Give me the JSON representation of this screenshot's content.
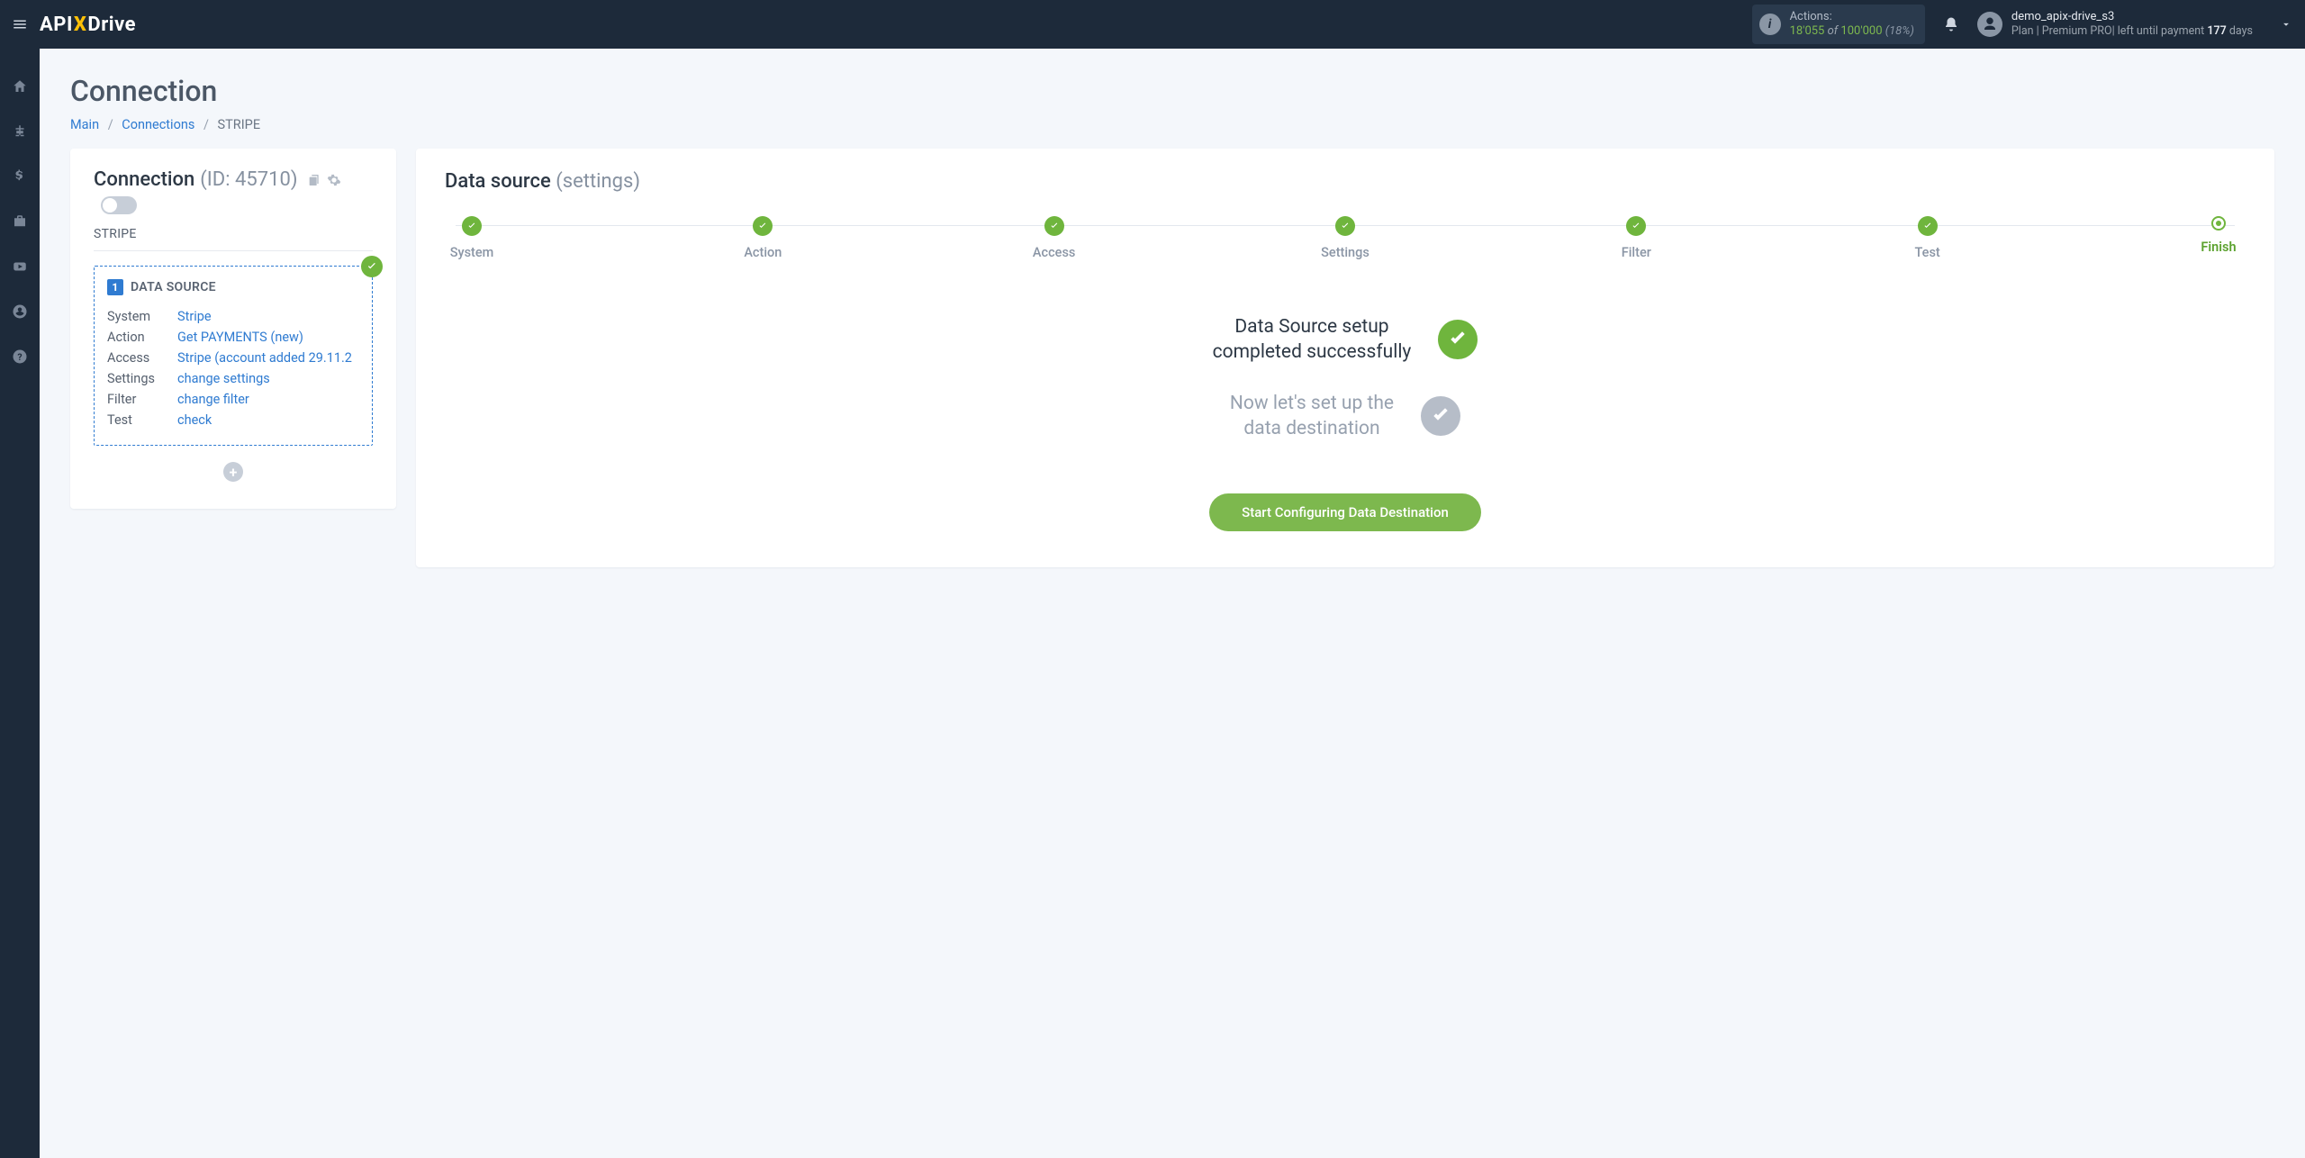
{
  "header": {
    "logo_pre": "API",
    "logo_x": "X",
    "logo_post": "Drive",
    "actions_label": "Actions:",
    "actions_used": "18'055",
    "actions_of": "of",
    "actions_total": "100'000",
    "actions_pct": "(18%)",
    "user_name": "demo_apix-drive_s3",
    "plan_prefix": "Plan |",
    "plan_name": "Premium PRO",
    "plan_suffix": "| left until payment",
    "plan_days": "177",
    "plan_days_word": "days"
  },
  "page": {
    "title": "Connection",
    "crumb_main": "Main",
    "crumb_connections": "Connections",
    "crumb_current": "STRIPE"
  },
  "left": {
    "title": "Connection",
    "id_label": "(ID: 45710)",
    "service": "STRIPE",
    "ds_num": "1",
    "ds_title": "DATA SOURCE",
    "rows": {
      "system_k": "System",
      "system_v": "Stripe",
      "action_k": "Action",
      "action_v": "Get PAYMENTS (new)",
      "access_k": "Access",
      "access_v": "Stripe (account added 29.11.2",
      "settings_k": "Settings",
      "settings_v": "change settings",
      "filter_k": "Filter",
      "filter_v": "change filter",
      "test_k": "Test",
      "test_v": "check"
    }
  },
  "right": {
    "title": "Data source",
    "title_sub": "(settings)",
    "steps": [
      "System",
      "Action",
      "Access",
      "Settings",
      "Filter",
      "Test",
      "Finish"
    ],
    "msg1_l1": "Data Source setup",
    "msg1_l2": "completed successfully",
    "msg2_l1": "Now let's set up the",
    "msg2_l2": "data destination",
    "cta": "Start Configuring Data Destination"
  }
}
